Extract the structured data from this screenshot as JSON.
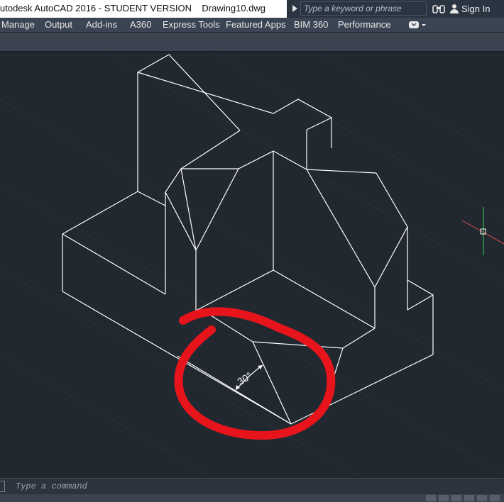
{
  "titlebar": {
    "title": "utodesk AutoCAD 2016 - STUDENT VERSION    Drawing10.dwg",
    "search_placeholder": "Type a keyword or phrase",
    "binoculars_icon": "binoculars-icon",
    "signin_label": "Sign In"
  },
  "ribbon": {
    "tabs": [
      {
        "label": "Manage"
      },
      {
        "label": "Output"
      },
      {
        "label": "Add-ins"
      },
      {
        "label": "A360"
      },
      {
        "label": "Express Tools"
      },
      {
        "label": "Featured Apps"
      },
      {
        "label": "BIM 360"
      },
      {
        "label": "Performance"
      }
    ],
    "overflow_icon": "ribbon-toggle-icon"
  },
  "drawing": {
    "dimension_text": "30°",
    "colors": {
      "background": "#212830",
      "lines": "#ffffff",
      "annotation": "#e8141c",
      "ucs_x": "#e0505a",
      "ucs_y": "#3cd14a"
    }
  },
  "command_line": {
    "placeholder": "Type a command"
  }
}
